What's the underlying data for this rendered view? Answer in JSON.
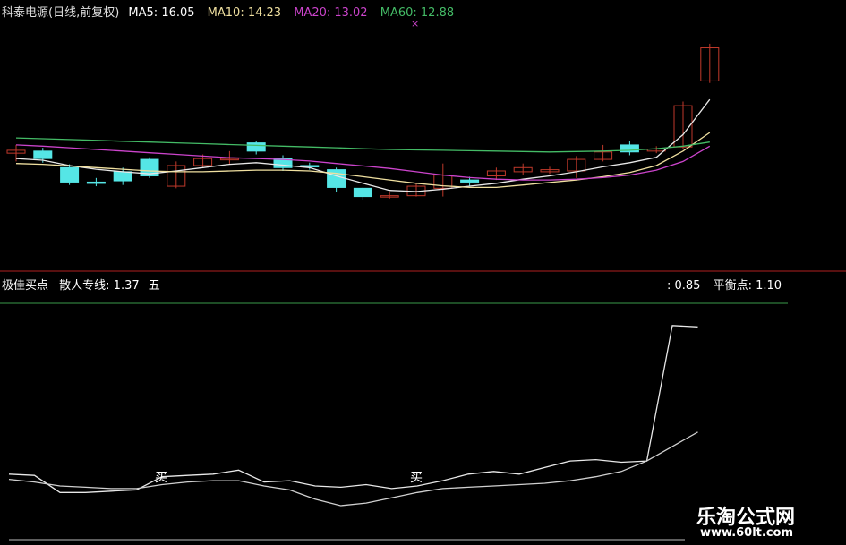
{
  "header": {
    "stock": "科泰电源(日线,前复权)",
    "ma5": "MA5: 16.05",
    "ma10": "MA10: 14.23",
    "ma20": "MA20: 13.02",
    "ma60": "MA60: 12.88"
  },
  "indicator": {
    "left_label": "极佳买点",
    "retail_line": "散人专线: 1.37",
    "retail_suffix": "五",
    "right_value": ": 0.85",
    "balance_point": "平衡点: 1.10"
  },
  "watermark": {
    "title": "乐淘公式网",
    "url": "www.60lt.com"
  },
  "colors": {
    "background": "#000000",
    "up_candle": "#c0392b",
    "down_candle": "#55e6e6",
    "ma5": "#e8e8e8",
    "ma10": "#f0e0a0",
    "ma20": "#cc44cc",
    "ma60": "#44bb66",
    "indicator": "#ffffff",
    "divider": "#b02020"
  },
  "chart_data": [
    {
      "type": "candlestick",
      "title": "科泰电源(日线,前复权)",
      "y_range": [
        12.0,
        18.2
      ],
      "candles": [
        {
          "open": 14.75,
          "close": 14.82,
          "high": 14.95,
          "low": 14.55
        },
        {
          "open": 14.8,
          "close": 14.62,
          "high": 14.88,
          "low": 14.52
        },
        {
          "open": 14.4,
          "close": 14.05,
          "high": 14.48,
          "low": 13.98
        },
        {
          "open": 14.05,
          "close": 14.02,
          "high": 14.15,
          "low": 13.95
        },
        {
          "open": 14.3,
          "close": 14.08,
          "high": 14.4,
          "low": 13.98
        },
        {
          "open": 14.6,
          "close": 14.2,
          "high": 14.65,
          "low": 14.15
        },
        {
          "open": 13.95,
          "close": 14.45,
          "high": 14.55,
          "low": 13.9
        },
        {
          "open": 14.45,
          "close": 14.62,
          "high": 14.72,
          "low": 14.4
        },
        {
          "open": 14.6,
          "close": 14.62,
          "high": 14.8,
          "low": 14.48
        },
        {
          "open": 15.0,
          "close": 14.8,
          "high": 15.05,
          "low": 14.72
        },
        {
          "open": 14.62,
          "close": 14.4,
          "high": 14.7,
          "low": 14.32
        },
        {
          "open": 14.45,
          "close": 14.42,
          "high": 14.52,
          "low": 14.35
        },
        {
          "open": 14.35,
          "close": 13.92,
          "high": 14.4,
          "low": 13.82
        },
        {
          "open": 13.9,
          "close": 13.7,
          "high": 13.92,
          "low": 13.62
        },
        {
          "open": 13.7,
          "close": 13.72,
          "high": 13.8,
          "low": 13.65
        },
        {
          "open": 13.72,
          "close": 13.95,
          "high": 14.02,
          "low": 13.7
        },
        {
          "open": 13.9,
          "close": 14.22,
          "high": 14.5,
          "low": 13.7
        },
        {
          "open": 14.1,
          "close": 14.05,
          "high": 14.18,
          "low": 13.95
        },
        {
          "open": 14.2,
          "close": 14.32,
          "high": 14.4,
          "low": 14.1
        },
        {
          "open": 14.3,
          "close": 14.4,
          "high": 14.5,
          "low": 14.22
        },
        {
          "open": 14.3,
          "close": 14.35,
          "high": 14.42,
          "low": 14.25
        },
        {
          "open": 14.32,
          "close": 14.6,
          "high": 14.68,
          "low": 14.15
        },
        {
          "open": 14.6,
          "close": 14.78,
          "high": 14.95,
          "low": 14.55
        },
        {
          "open": 14.95,
          "close": 14.78,
          "high": 15.05,
          "low": 14.7
        },
        {
          "open": 14.8,
          "close": 14.85,
          "high": 14.92,
          "low": 14.75
        },
        {
          "open": 14.9,
          "close": 15.9,
          "high": 16.0,
          "low": 14.85
        },
        {
          "open": 16.5,
          "close": 17.3,
          "high": 17.4,
          "low": 16.45
        }
      ],
      "series": [
        {
          "name": "MA5",
          "values": [
            14.62,
            14.58,
            14.45,
            14.36,
            14.3,
            14.25,
            14.32,
            14.4,
            14.48,
            14.52,
            14.46,
            14.4,
            14.2,
            14.02,
            13.85,
            13.82,
            13.88,
            13.95,
            14.02,
            14.12,
            14.2,
            14.3,
            14.42,
            14.52,
            14.65,
            15.2,
            16.05
          ]
        },
        {
          "name": "MA10",
          "values": [
            14.5,
            14.48,
            14.44,
            14.4,
            14.36,
            14.32,
            14.3,
            14.3,
            14.32,
            14.34,
            14.34,
            14.32,
            14.26,
            14.18,
            14.1,
            14.02,
            13.96,
            13.92,
            13.92,
            13.98,
            14.04,
            14.1,
            14.18,
            14.28,
            14.45,
            14.8,
            15.25
          ]
        },
        {
          "name": "MA20",
          "values": [
            14.95,
            14.92,
            14.88,
            14.84,
            14.8,
            14.76,
            14.72,
            14.68,
            14.64,
            14.62,
            14.6,
            14.56,
            14.5,
            14.44,
            14.38,
            14.3,
            14.22,
            14.16,
            14.12,
            14.1,
            14.1,
            14.12,
            14.16,
            14.22,
            14.34,
            14.55,
            14.92
          ]
        },
        {
          "name": "MA60",
          "values": [
            15.12,
            15.1,
            15.08,
            15.06,
            15.04,
            15.02,
            15.0,
            14.98,
            14.96,
            14.94,
            14.92,
            14.9,
            14.88,
            14.86,
            14.84,
            14.83,
            14.82,
            14.81,
            14.8,
            14.79,
            14.78,
            14.79,
            14.8,
            14.82,
            14.86,
            14.92,
            15.02
          ]
        }
      ]
    },
    {
      "type": "line",
      "y_range": [
        0.0,
        1.6
      ],
      "series": [
        {
          "name": "散人专线",
          "values": [
            0.24,
            0.23,
            0.1,
            0.1,
            0.11,
            0.12,
            0.22,
            0.23,
            0.24,
            0.27,
            0.18,
            0.19,
            0.15,
            0.14,
            0.16,
            0.13,
            0.15,
            0.19,
            0.24,
            0.26,
            0.24,
            0.29,
            0.34,
            0.35,
            0.33,
            0.34,
            1.37,
            1.36
          ]
        },
        {
          "name": "平衡点",
          "values": [
            0.2,
            0.18,
            0.15,
            0.14,
            0.13,
            0.13,
            0.16,
            0.18,
            0.19,
            0.19,
            0.15,
            0.12,
            0.05,
            0.0,
            0.02,
            0.06,
            0.1,
            0.13,
            0.14,
            0.15,
            0.16,
            0.17,
            0.19,
            0.22,
            0.26,
            0.34,
            0.45,
            0.56
          ]
        }
      ],
      "annotations": [
        {
          "text": "买",
          "x_index": 6
        },
        {
          "text": "买",
          "x_index": 16
        }
      ]
    }
  ]
}
